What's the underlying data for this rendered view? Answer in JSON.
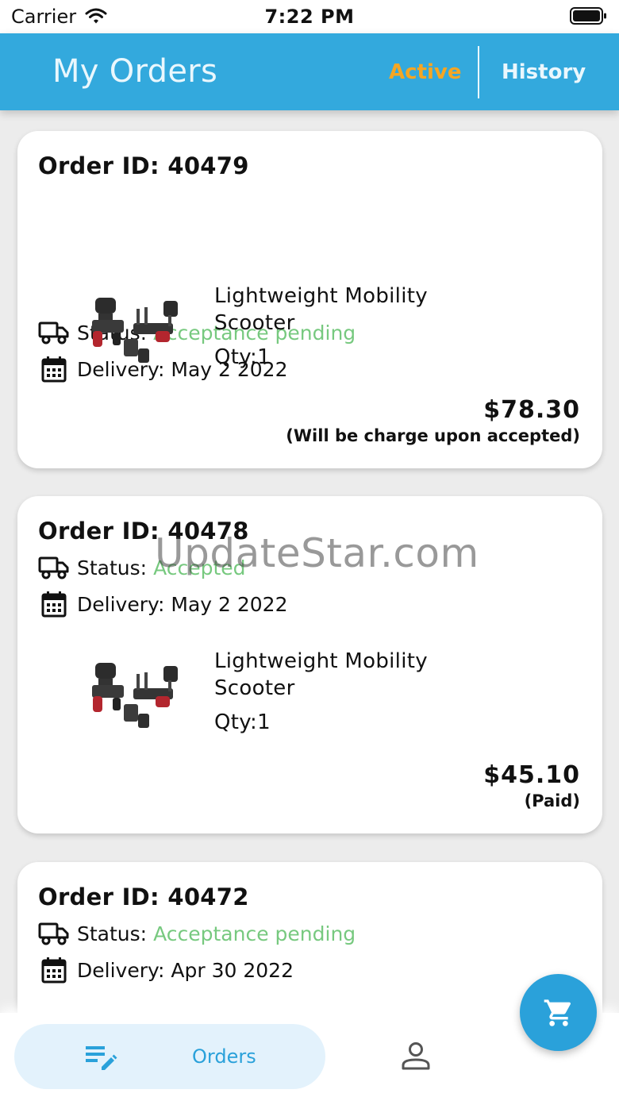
{
  "status_bar": {
    "carrier": "Carrier",
    "time": "7:22 PM"
  },
  "header": {
    "title": "My Orders",
    "tabs": [
      {
        "label": "Active",
        "selected": true
      },
      {
        "label": "History",
        "selected": false
      }
    ]
  },
  "labels": {
    "status_prefix": "Status:",
    "delivery_prefix": "Delivery:"
  },
  "orders": [
    {
      "id_text": "Order ID: 40479",
      "status": "Acceptance pending",
      "delivery": "May 2 2022",
      "item": {
        "name": "Lightweight Mobility Scooter",
        "qty": "Qty:1"
      },
      "price": "$78.30",
      "note": "(Will be charge upon accepted)"
    },
    {
      "id_text": "Order ID: 40478",
      "status": "Accepted",
      "delivery": "May 2 2022",
      "item": {
        "name": "Lightweight Mobility Scooter",
        "qty": "Qty:1"
      },
      "price": "$45.10",
      "note": "(Paid)"
    },
    {
      "id_text": "Order ID: 40472",
      "status": "Acceptance pending",
      "delivery": "Apr 30 2022"
    }
  ],
  "watermark": "UpdateStar.com",
  "bottom_nav": {
    "items": [
      {
        "label": "Orders",
        "icon": "edit-list-icon",
        "selected": true
      },
      {
        "label": "",
        "icon": "person-icon",
        "selected": false
      }
    ]
  },
  "fab": {
    "icon": "cart-icon"
  },
  "colors": {
    "primary": "#33a9dd",
    "accent_orange": "#f5a623",
    "status_green": "#77c97f",
    "nav_blue": "#2aa1da"
  }
}
